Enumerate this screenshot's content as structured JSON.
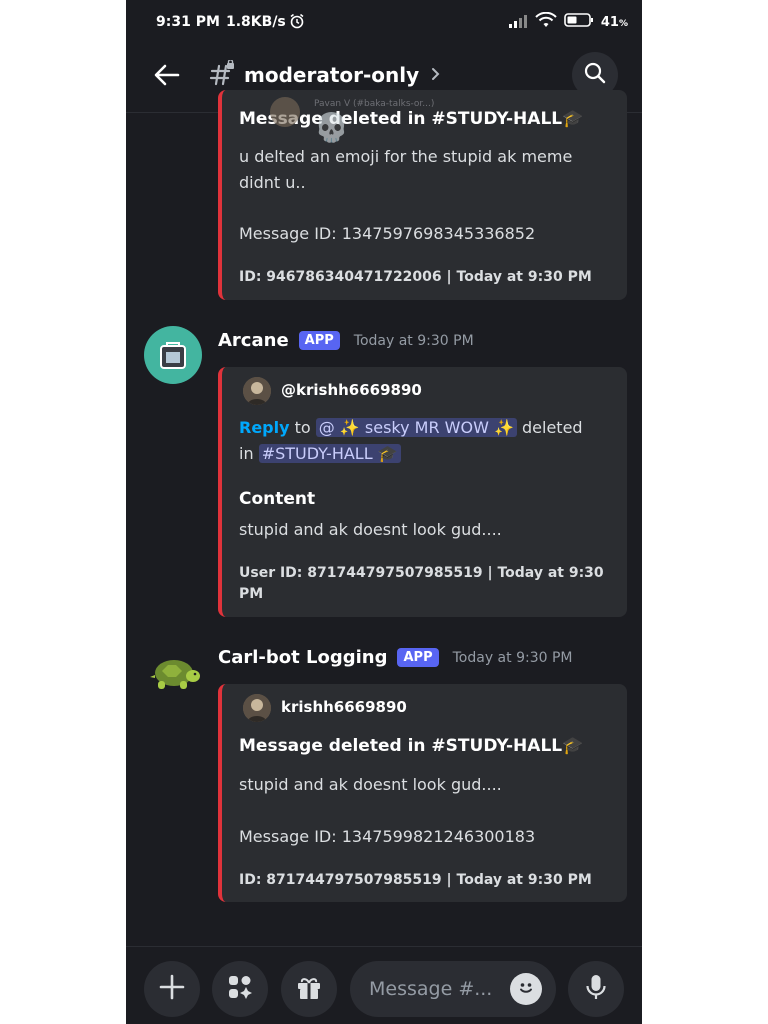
{
  "status": {
    "time": "9:31 PM",
    "speed": "1.8KB/s",
    "battery": "41"
  },
  "header": {
    "channel": "moderator-only"
  },
  "preview_ghost": {
    "text": "Pavan V (#baka-talks-or...)"
  },
  "msg1": {
    "title_prefix": "Message deleted in #",
    "title_channel": "STUDY-HALL",
    "body_line1": "u delted an emoji for the stupid ak meme",
    "body_line2": "didnt u..",
    "message_id": "Message ID: 1347597698345336852",
    "footer": "ID: 946786340471722006 | Today at 9:30 PM"
  },
  "msg2": {
    "author": "Arcane",
    "badge": "APP",
    "time": "Today at 9:30 PM",
    "embed_user": "@krishh6669890",
    "reply": "Reply",
    "to": "to",
    "mention_user": "@ ✨ sesky MR WOW ✨",
    "deleted": "deleted",
    "in": "in",
    "mention_channel": "#STUDY-HALL",
    "content_label": "Content",
    "content": "stupid and ak doesnt look gud....",
    "footer_line1": "User ID: 871744797507985519 | Today at 9:30",
    "footer_line2": "PM"
  },
  "msg3": {
    "author": "Carl-bot Logging",
    "badge": "APP",
    "time": "Today at 9:30 PM",
    "embed_user": "krishh6669890",
    "title_prefix": "Message deleted in #",
    "title_channel": "STUDY-HALL",
    "content": "stupid and ak doesnt look gud....",
    "message_id": "Message ID: 1347599821246300183",
    "footer": "ID: 871744797507985519 | Today at 9:30 PM"
  },
  "composer": {
    "placeholder": "Message #..."
  }
}
